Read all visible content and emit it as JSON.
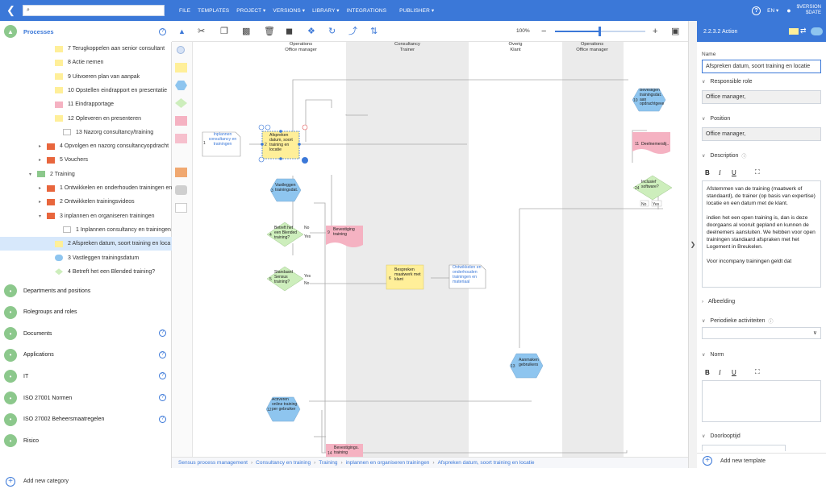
{
  "search": {
    "value": ""
  },
  "menu": [
    "FILE",
    "TEMPLATES",
    "PROJECT",
    "VERSIONS",
    "LIBRARY",
    "INTEGRATIONS",
    "PUBLISHER"
  ],
  "menu_arrows": [
    "",
    "",
    "▾",
    "▾",
    "▾",
    "",
    "▾"
  ],
  "lang": "EN",
  "version": {
    "line1": "$VERSION",
    "line2": "$DATE"
  },
  "left": {
    "processes_title": "Processes",
    "tree": [
      {
        "label": "7 Terugkoppelen aan senior consultant",
        "color": "#ffef99",
        "indent": 68,
        "twisty": ""
      },
      {
        "label": "8 Actie nemen",
        "color": "#ffef99",
        "indent": 68,
        "twisty": ""
      },
      {
        "label": "9 Uitvoeren plan van aanpak",
        "color": "#ffef99",
        "indent": 68,
        "twisty": ""
      },
      {
        "label": "10 Opstellen eindrapport en presentatie",
        "color": "#ffef99",
        "indent": 68,
        "twisty": ""
      },
      {
        "label": "11 Eindrapportage",
        "color": "#f5b2c2",
        "indent": 68,
        "twisty": ""
      },
      {
        "label": "12 Opleveren en presenteren",
        "color": "#ffef99",
        "indent": 68,
        "twisty": ""
      },
      {
        "label": "13 Nazorg consultancy/training",
        "color": "#ffffff",
        "indent": 78,
        "twisty": ""
      },
      {
        "label": "4 Opvolgen en nazorg consultancyopdracht",
        "color": "#e8663d",
        "indent": 58,
        "twisty": "▸"
      },
      {
        "label": "5 Vouchers",
        "color": "#e8663d",
        "indent": 58,
        "twisty": "▸"
      },
      {
        "label": "2 Training",
        "color": "#8cc88c",
        "indent": 46,
        "twisty": "▾"
      },
      {
        "label": "1 Ontwikkelen en onderhouden trainingen en",
        "color": "#e8663d",
        "indent": 58,
        "twisty": "▸"
      },
      {
        "label": "2 Ontwikkelen trainingsvideos",
        "color": "#e8663d",
        "indent": 58,
        "twisty": "▸"
      },
      {
        "label": "3 inplannen en organiseren trainingen",
        "color": "#e8663d",
        "indent": 58,
        "twisty": "▾"
      },
      {
        "label": "1 Inplannen consultancy en trainingen",
        "color": "#ffffff",
        "indent": 78,
        "twisty": ""
      },
      {
        "label": "2 Afspreken datum, soort training en loca",
        "color": "#ffef99",
        "indent": 68,
        "twisty": ""
      },
      {
        "label": "3 Vastleggen trainingsdatum",
        "color": "#8ec5ef",
        "indent": 68,
        "twisty": ""
      },
      {
        "label": "4 Betreft het een Blended training?",
        "color": "#cdeebc",
        "indent": 68,
        "twisty": ""
      }
    ],
    "categories": [
      {
        "label": "Departments and positions",
        "help": false
      },
      {
        "label": "Rolegroups and roles",
        "help": false
      },
      {
        "label": "Documents",
        "help": true
      },
      {
        "label": "Applications",
        "help": true
      },
      {
        "label": "IT",
        "help": true
      },
      {
        "label": "ISO 27001 Normen",
        "help": true
      },
      {
        "label": "ISO 27002 Beheersmaatregelen",
        "help": true
      },
      {
        "label": "Risico",
        "help": false
      }
    ],
    "add_category": "Add new category"
  },
  "toolbar": {
    "zoom": "100%"
  },
  "lanes": [
    {
      "title1": "Operations",
      "title2": "Office manager"
    },
    {
      "title1": "Consultancy",
      "title2": "Trainer"
    },
    {
      "title1": "Overig",
      "title2": "Klant"
    },
    {
      "title1": "Operations",
      "title2": "Office manager"
    }
  ],
  "shapes": {
    "s1": "Inplannen consultancy en trainingen",
    "s2": "Afspreken datum, soort training en locatie",
    "s3": "Vastleggen trainingsdat.",
    "s4": "Betreft het een Blended training?",
    "s5": "Standaard Sensus training?",
    "s6": "Bespreken maatwerk met klant",
    "s7": "Ontwikkelen en onderhouden trainingen en materiaal",
    "s9": "Bevestiging training",
    "s10": "Bevestigen trainingsdat. aan opdrachtgever",
    "s11": "Deelnemerslij..",
    "s12": "Activeren online training per gebruiker",
    "s13": "Aanmaken gebruikers",
    "s14": "Bevestigings. training",
    "s24": "Inclusief software?",
    "yes": "Yes",
    "no": "No",
    "n1": "1",
    "n2": "2",
    "n3": "3",
    "n4": "4",
    "n5": "5",
    "n6": "6",
    "n9": "9",
    "n10": "10",
    "n11": "11",
    "n12": "12",
    "n13": "13",
    "n14": "14",
    "n24": "24"
  },
  "breadcrumbs": [
    "Sensus process management",
    "Consultancy en training",
    "Training",
    "inplannen en organiseren trainingen",
    "Afspreken datum, soort training en locatie"
  ],
  "right": {
    "header": "2.2.3.2 Action",
    "name_label": "Name",
    "name_value": "Afspreken datum, soort training en locatie",
    "role_label": "Responsible role",
    "role_value": "Office manager,",
    "position_label": "Position",
    "position_value": "Office manager,",
    "description_label": "Description",
    "description_p1": "Afstemmen van de training (maatwerk of standaard), de trainer (op basis van expertise) locatie en een datum met de klant.",
    "description_p2": "indien het een open training is, dan is deze doorgaans al vooruit gepland en kunnen de deelnemers aansluiten. We hebben voor open trainingen standaard afspraken met het Logement in Breukelen.",
    "description_p3": "Voor incompany trainingen geldt dat",
    "afbeelding_label": "Afbeelding",
    "periodieke_label": "Periodieke activiteiten",
    "norm_label": "Norm",
    "doorlooptijd_label": "Doorlooptijd",
    "add_template": "Add new template",
    "fmt_b": "B",
    "fmt_i": "I",
    "fmt_u": "U"
  },
  "colors": {
    "accent": "#3b78d8",
    "action": "#ffef99",
    "event": "#8ec5ef",
    "decision": "#cdeebc",
    "document": "#f5b2c2"
  }
}
